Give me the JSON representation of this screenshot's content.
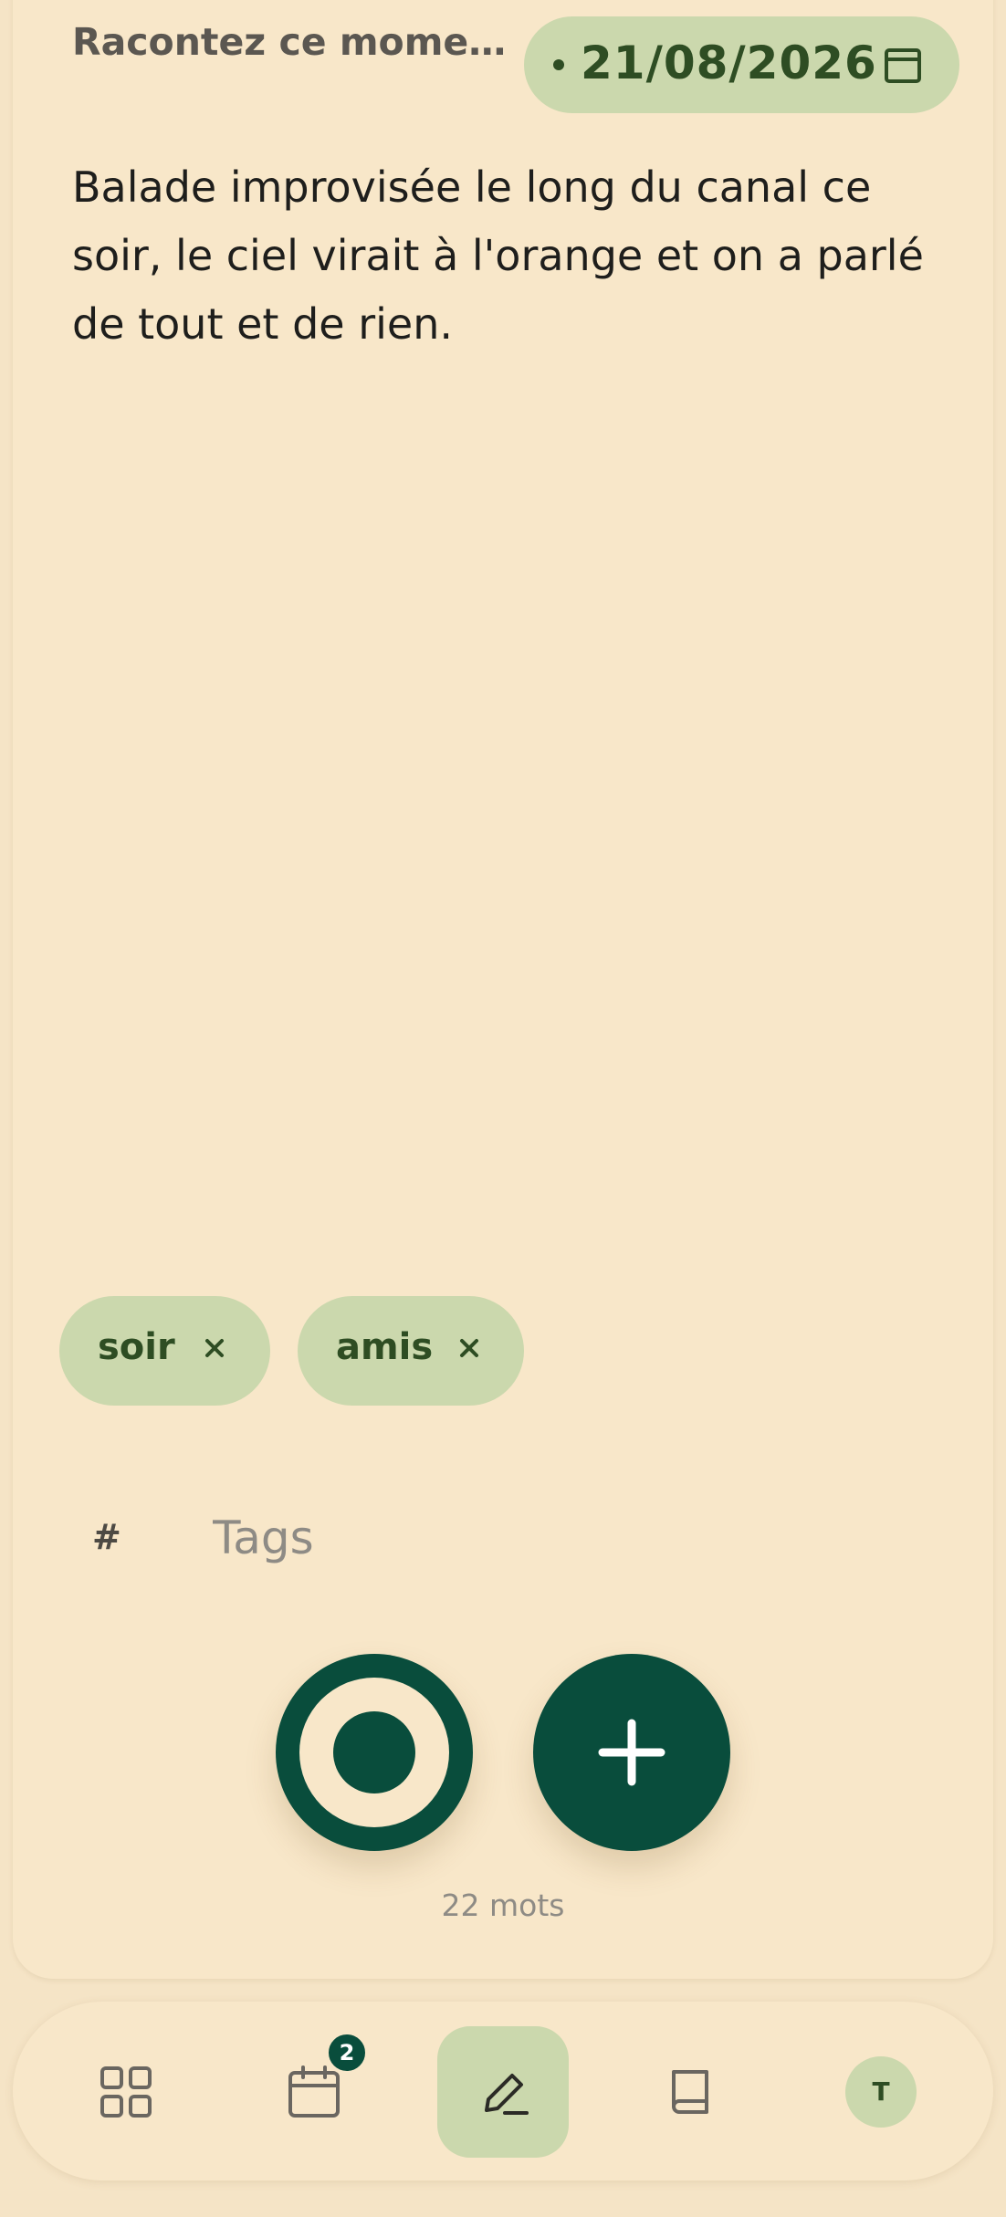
{
  "entry": {
    "prompt": "Racontez ce mome…",
    "date": "21/08/2026",
    "text": "Balade improvisée le long du canal ce soir, le ciel virait à l'orange et on a parlé de tout et de rien."
  },
  "tags": {
    "items": [
      {
        "label": "soir",
        "remove_icon": "close-icon"
      },
      {
        "label": "amis",
        "remove_icon": "close-icon"
      }
    ],
    "hash": "#",
    "input_value": "",
    "placeholder": "Tags"
  },
  "actions": {
    "record_icon": "record-icon",
    "add_icon": "plus-icon"
  },
  "word_count": "22 mots",
  "nav": {
    "items": [
      {
        "icon": "grid-icon",
        "active": false
      },
      {
        "icon": "calendar-icon",
        "active": false,
        "badge": "2"
      },
      {
        "icon": "pen-icon",
        "active": true
      },
      {
        "icon": "book-icon",
        "active": false
      },
      {
        "icon": "avatar",
        "active": false,
        "avatar_initial": "T"
      }
    ]
  },
  "colors": {
    "background": "#f5e4c6",
    "card": "#f8e7c9",
    "chip": "#cbd8ad",
    "chip_text": "#2e4d23",
    "accent": "#094d3c",
    "muted_text": "#8e8b85"
  }
}
